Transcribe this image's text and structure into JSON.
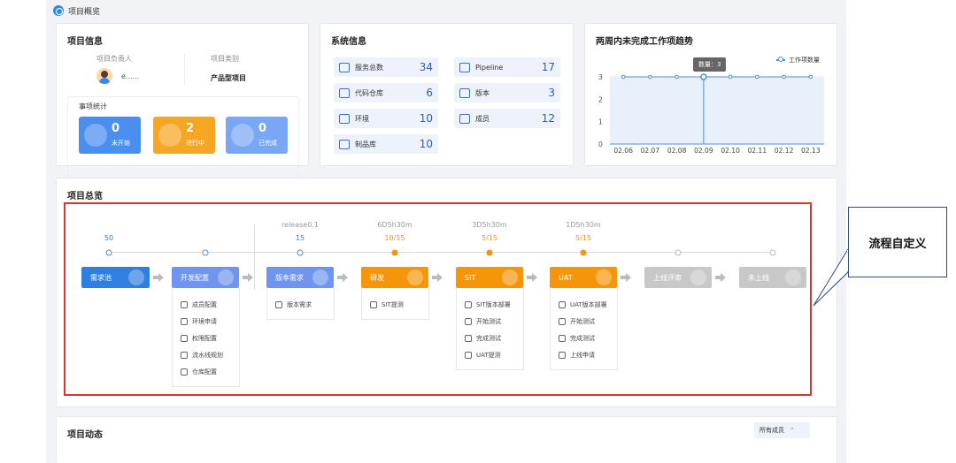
{
  "page": {
    "breadcrumb": "项目概览"
  },
  "project_info": {
    "title": "项目信息",
    "owner_label": "项目负责人",
    "owner_name": "e......",
    "type_label": "项目类别",
    "type_value": "产品型项目",
    "stats_title": "事项统计",
    "stats": [
      {
        "num": "0",
        "label": "未开始",
        "color": "#4a8ef0"
      },
      {
        "num": "2",
        "label": "进行中",
        "color": "#f5a623"
      },
      {
        "num": "0",
        "label": "已完成",
        "color": "#7aa7f5"
      }
    ]
  },
  "system_info": {
    "title": "系统信息",
    "items": [
      {
        "label": "服务总数",
        "value": "34",
        "icon": "service-icon"
      },
      {
        "label": "Pipeline",
        "value": "17",
        "icon": "pipeline-icon"
      },
      {
        "label": "代码仓库",
        "value": "6",
        "icon": "code-repo-icon"
      },
      {
        "label": "版本",
        "value": "3",
        "icon": "version-icon"
      },
      {
        "label": "环境",
        "value": "10",
        "icon": "environment-icon"
      },
      {
        "label": "成员",
        "value": "12",
        "icon": "members-icon"
      },
      {
        "label": "制品库",
        "value": "10",
        "icon": "artifact-icon"
      }
    ]
  },
  "chart_data": {
    "type": "line",
    "title": "两周内未完成工作项趋势",
    "categories": [
      "02.06",
      "02.07",
      "02.08",
      "02.09",
      "02.10",
      "02.11",
      "02.12",
      "02.13"
    ],
    "series": [
      {
        "name": "工作项数量",
        "values": [
          3,
          3,
          3,
          3,
          3,
          3,
          3,
          3
        ]
      }
    ],
    "ylim": [
      0,
      3
    ],
    "yticks": [
      "0",
      "1",
      "2",
      "3"
    ],
    "tooltip": "数量：3",
    "tooltip_index": 3,
    "legend": "top-right",
    "color": "#4a90d9"
  },
  "overview": {
    "title": "项目总览",
    "release_label": "release0.1",
    "stages": [
      {
        "name": "需求池",
        "top": "",
        "count": "50",
        "state": "blue",
        "items": []
      },
      {
        "name": "开发配置",
        "top": "",
        "count": "",
        "state": "done",
        "items": [
          {
            "label": "成员配置",
            "icon": "members-icon"
          },
          {
            "label": "环境申请",
            "icon": "form-icon"
          },
          {
            "label": "权限配置",
            "icon": "shield-icon"
          },
          {
            "label": "流水线规划",
            "icon": "pipeline-icon"
          },
          {
            "label": "仓库配置",
            "icon": "home-icon"
          }
        ]
      },
      {
        "name": "版本需求",
        "top": "",
        "count": "15",
        "state": "done",
        "items": [
          {
            "label": "版本需求",
            "icon": "target-icon"
          }
        ]
      },
      {
        "name": "研发",
        "top": "6D5h30m",
        "count": "10/15",
        "state": "active",
        "items": [
          {
            "label": "SIT提测",
            "icon": "submit-icon"
          }
        ]
      },
      {
        "name": "SIT",
        "top": "3D5h30m",
        "count": "5/15",
        "state": "active",
        "items": [
          {
            "label": "SIT版本部署",
            "icon": "deploy-icon"
          },
          {
            "label": "开始测试",
            "icon": "play-icon"
          },
          {
            "label": "完成测试",
            "icon": "check-circle-icon"
          },
          {
            "label": "UAT提测",
            "icon": "submit-icon"
          }
        ]
      },
      {
        "name": "UAT",
        "top": "1D5h30m",
        "count": "5/15",
        "state": "active",
        "items": [
          {
            "label": "UAT版本部署",
            "icon": "deploy-icon"
          },
          {
            "label": "开始测试",
            "icon": "play-icon"
          },
          {
            "label": "完成测试",
            "icon": "check-circle-icon"
          },
          {
            "label": "上线申请",
            "icon": "release-icon"
          }
        ]
      },
      {
        "name": "上线评审",
        "top": "",
        "count": "",
        "state": "todo",
        "items": []
      },
      {
        "name": "未上线",
        "top": "",
        "count": "",
        "state": "todo",
        "items": []
      }
    ],
    "callout": "流程自定义"
  },
  "activity": {
    "title": "项目动态",
    "filter_label": "所有成员"
  },
  "colors": {
    "blue": "#2f7fe0",
    "done": "#6f95ee",
    "active": "#f5960a",
    "todo": "#c8c8c8",
    "count_blue": "#3a7bd5",
    "count_orange": "#f5960a"
  }
}
